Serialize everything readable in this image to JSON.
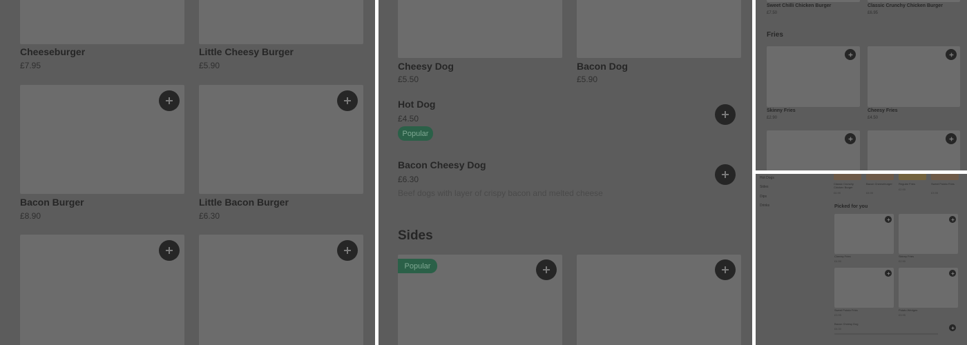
{
  "panel1": {
    "items": [
      {
        "name": "Cheeseburger",
        "price": "£7.95"
      },
      {
        "name": "Little Cheesy Burger",
        "price": "£5.90"
      },
      {
        "name": "Bacon Burger",
        "price": "£8.90"
      },
      {
        "name": "Little Bacon Burger",
        "price": "£6.30"
      }
    ]
  },
  "panel2": {
    "items": [
      {
        "name": "Cheesy Dog",
        "price": "£5.50"
      },
      {
        "name": "Bacon Dog",
        "price": "£5.90"
      }
    ],
    "hot_dog": {
      "name": "Hot Dog",
      "price": "£4.50",
      "badge": "Popular"
    },
    "bacon_cheesy_dog": {
      "name": "Bacon Cheesy Dog",
      "price": "£6.30",
      "description": "Beef dogs with layer of crispy bacon and melted cheese"
    },
    "sides_heading": "Sides",
    "sides_badge": "Popular"
  },
  "panel3": {
    "top_items": [
      {
        "name": "Sweet Chilli Chicken Burger",
        "price": "£7.50"
      },
      {
        "name": "Classic Crunchy Chicken Burger",
        "price": "£6.95"
      }
    ],
    "fries_heading": "Fries",
    "fries": [
      {
        "name": "Skinny Fries",
        "price": "£2.90"
      },
      {
        "name": "Cheesy Fries",
        "price": "£4.50"
      }
    ]
  },
  "panel4": {
    "nav": [
      "Hot Dogs",
      "Sides",
      "Dips",
      "Drinks"
    ],
    "top_strip": [
      {
        "name": "Classic Crunchy Chicken Burger",
        "price": "£6.95"
      },
      {
        "name": "Bacon Cheeseburger",
        "price": "£8.95"
      },
      {
        "name": "Regular Fries",
        "price": "£2.95"
      },
      {
        "name": "Sweet Potato Fries",
        "price": "£3.95"
      }
    ],
    "picked_heading": "Picked for you",
    "picked": [
      {
        "name": "Cheesy Fries",
        "price": "£4.50"
      },
      {
        "name": "Skinny Fries",
        "price": "£2.90"
      },
      {
        "name": "Sweet Potato Fries",
        "price": "£3.95"
      },
      {
        "name": "Potato Wedges",
        "price": "£3.95"
      }
    ],
    "bottom_item": {
      "name": "Bacon Cheesy Dog",
      "price": "£6.30"
    }
  },
  "colors": {
    "overlay": "#5c5c5c",
    "image": "#6c6c6c",
    "button": "#262626",
    "badge": "#2b6048",
    "divider": "#ffffff"
  },
  "icons": {
    "add": "plus-icon"
  }
}
